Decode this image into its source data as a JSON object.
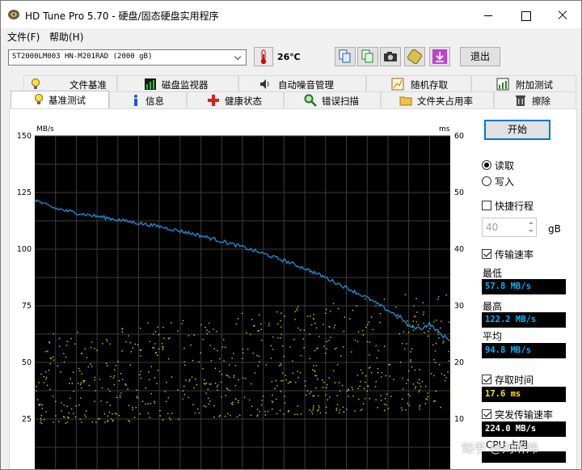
{
  "window": {
    "title": "HD Tune Pro 5.70 - 硬盘/固态硬盘实用程序"
  },
  "menu": {
    "file": "文件(F)",
    "help": "帮助(H)"
  },
  "toolbar": {
    "drive": "ST2000LM003 HN-M201RAD (2000 gB)",
    "temperature": "26℃",
    "exit_label": "退出"
  },
  "tabs_top": [
    "文件基准",
    "磁盘监视器",
    "自动噪音管理",
    "随机存取",
    "附加测试"
  ],
  "tabs_bottom": [
    "基准测试",
    "信息",
    "健康状态",
    "错误扫描",
    "文件夹占用率",
    "擦除"
  ],
  "controls": {
    "start_label": "开始",
    "read_label": "读取",
    "write_label": "写入",
    "short_stroke_label": "快捷行程",
    "short_stroke_value": "40",
    "short_stroke_unit": "gB",
    "transfer_rate_label": "传输速率",
    "min_label": "最低",
    "min_value": "57.8 MB/s",
    "max_label": "最高",
    "max_value": "122.2 MB/s",
    "avg_label": "平均",
    "avg_value": "94.8 MB/s",
    "access_time_label": "存取时间",
    "access_time_value": "17.6 ms",
    "burst_label": "突发传输速率",
    "burst_value": "224.0 MB/s",
    "cpu_partial": "CPU 占用"
  },
  "watermark": "知乎 @刘昕炜",
  "chart_data": {
    "type": "line",
    "y_left_label": "MB/s",
    "y_right_label": "ms",
    "y_left_ticks": [
      150,
      125,
      100,
      75,
      50,
      25
    ],
    "y_right_ticks": [
      60,
      50,
      40,
      30,
      20,
      10
    ],
    "y_left_range": [
      0,
      150
    ],
    "y_right_range": [
      0,
      60
    ],
    "grid": true,
    "series": [
      {
        "kind": "transfer_rate",
        "axis": "left",
        "color": "#1e90d6",
        "x": [
          0,
          2,
          5,
          10,
          15,
          20,
          25,
          30,
          35,
          40,
          45,
          50,
          55,
          60,
          65,
          70,
          75,
          80,
          85,
          88,
          90,
          93,
          95,
          98,
          100
        ],
        "values": [
          122,
          120,
          118,
          116,
          114.5,
          113,
          111.5,
          110,
          108,
          106,
          103.5,
          101,
          98,
          95,
          91.5,
          87.5,
          83,
          78.5,
          73,
          70,
          66,
          65,
          67,
          62,
          60
        ]
      },
      {
        "kind": "access_time",
        "axis": "right",
        "color": "#d8d800",
        "x_range": [
          0,
          100
        ],
        "ms_min_at_start": 9,
        "ms_max_at_start": 25,
        "ms_min_at_end": 12,
        "ms_max_at_end": 33
      }
    ]
  }
}
